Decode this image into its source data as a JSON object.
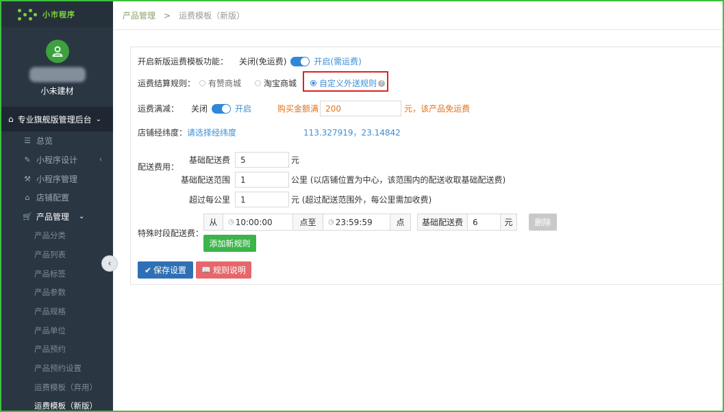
{
  "app": {
    "logo_text": "小市程序",
    "user_name": "小未建材"
  },
  "sidebar": {
    "group_label": "专业旗舰版管理后台",
    "items": [
      {
        "label": "总览",
        "icon": "list-icon"
      },
      {
        "label": "小程序设计",
        "icon": "pencil-icon"
      },
      {
        "label": "小程序管理",
        "icon": "wrench-icon"
      },
      {
        "label": "店铺配置",
        "icon": "home-icon"
      },
      {
        "label": "产品管理",
        "icon": "cart-icon"
      }
    ],
    "sub_items": [
      "产品分类",
      "产品列表",
      "产品标签",
      "产品参数",
      "产品规格",
      "产品单位",
      "产品预约",
      "产品预约设置",
      "运费模板（弃用）",
      "运费模板（新版）"
    ]
  },
  "breadcrumb": {
    "first": "产品管理",
    "sep": ">",
    "current": "运费模板（新版）"
  },
  "form": {
    "enable_label": "开启新版运费模板功能：",
    "enable_off": "关闭(免运费)",
    "enable_on": "开启(需运费)",
    "rule_label": "运费结算规则：",
    "rule_options": [
      "有赞商城",
      "淘宝商城",
      "自定义外送规则"
    ],
    "full_label": "运费满减：",
    "full_off": "关闭",
    "full_on": "开启",
    "full_buy_label": "购买金额满",
    "full_amount": "200",
    "full_suffix": "元，该产品免运费",
    "loc_label": "店铺经纬度：",
    "loc_link": "请选择经纬度",
    "loc_value": "113.327919，23.14842",
    "fee_label": "配送费用：",
    "base_fee_label": "基础配送费",
    "base_fee_value": "5",
    "base_fee_unit": "元",
    "range_label": "基础配送范围",
    "range_value": "1",
    "range_unit": "公里 (以店铺位置为中心，该范围内的配送收取基础配送费)",
    "per_km_label": "超过每公里",
    "per_km_value": "1",
    "per_km_unit": "元 (超过配送范围外，每公里需加收费)",
    "special_label": "特殊时段配送费：",
    "from": "从",
    "time_start": "10:00:00",
    "to": "点至",
    "time_end": "23:59:59",
    "point": "点",
    "special_fee_label": "基础配送费",
    "special_fee_value": "6",
    "special_fee_unit": "元",
    "delete": "删除",
    "add_rule": "添加新规则",
    "save": "保存设置",
    "rule_desc": "规则说明"
  },
  "colors": {
    "accent": "#2f88d6",
    "green": "#3bb54a",
    "orange": "#e0731c",
    "red": "#e02020",
    "sidebar": "#2b3643"
  }
}
